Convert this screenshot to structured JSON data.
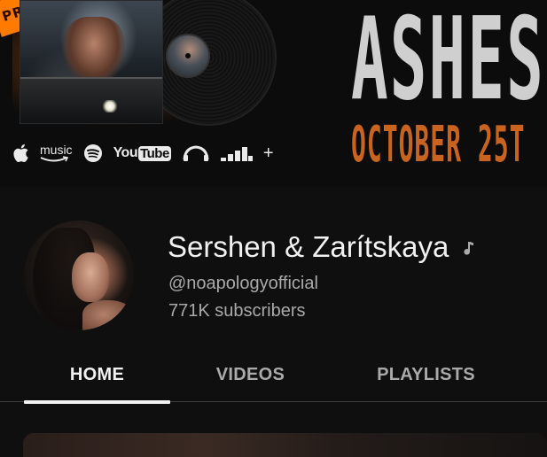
{
  "banner": {
    "promo_text": "PRE",
    "album_title": "ASHES",
    "release_date": "OCTOBER 25T",
    "platforms": [
      {
        "name": "apple-icon"
      },
      {
        "name": "amazon-music-icon",
        "label": "music"
      },
      {
        "name": "spotify-icon"
      },
      {
        "name": "youtube-logo",
        "label_a": "You",
        "label_b": "Tube"
      },
      {
        "name": "audiomack-icon"
      },
      {
        "name": "deezer-icon"
      },
      {
        "name": "more-platforms-icon",
        "label": "+"
      }
    ],
    "accent_color": "#c8641f"
  },
  "channel": {
    "name": "Sershen & Zarítskaya",
    "handle": "@noapologyofficial",
    "subscribers": "771K subscribers",
    "badge_icon": "music-note-icon"
  },
  "tabs": [
    {
      "label": "HOME",
      "active": true
    },
    {
      "label": "VIDEOS",
      "active": false
    },
    {
      "label": "PLAYLISTS",
      "active": false
    }
  ],
  "colors": {
    "background": "#0f0f0f",
    "text_primary": "#f1f1f1",
    "text_secondary": "#aaaaaa"
  }
}
